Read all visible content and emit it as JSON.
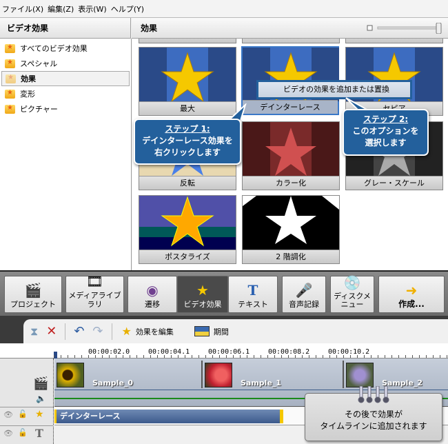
{
  "menu": [
    "ファイル(X)",
    "編集(Z)",
    "表示(W)",
    "ヘルプ(Y)"
  ],
  "left_panel": {
    "title": "ビデオ効果",
    "items": [
      "すべてのビデオ効果",
      "スペシャル",
      "効果",
      "変形",
      "ピクチャー"
    ],
    "selected": "効果"
  },
  "right_panel": {
    "title": "効果"
  },
  "tiles": [
    {
      "label": "最大"
    },
    {
      "label": "デインターレース"
    },
    {
      "label": "セピア"
    },
    {
      "label": "反転"
    },
    {
      "label": "カラー化"
    },
    {
      "label": "グレー・スケール"
    },
    {
      "label": "ポスタライズ"
    },
    {
      "label": "2 階調化"
    }
  ],
  "context_menu": {
    "item": "ビデオの効果を追加または置換"
  },
  "callout1": {
    "title": "ステップ 1:",
    "line1": "デインターレース効果を",
    "line2": "右クリックします"
  },
  "callout2": {
    "title": "ステップ 2:",
    "line1": "このオプションを",
    "line2": "選択します"
  },
  "toolbar": [
    "プロジェクト",
    "メディアライブラリ",
    "遷移",
    "ビデオ効果",
    "テキスト",
    "音声記録",
    "ディスクメニュー",
    "作成..."
  ],
  "toolbar_active": "ビデオ効果",
  "timeline_toolbar": {
    "edit_effect": "効果を編集",
    "duration": "期間"
  },
  "ruler": [
    "00:00:02.0",
    "00:00:04.1",
    "00:00:06.1",
    "00:00:08.2",
    "00:00:10.2"
  ],
  "clips": [
    "Sample_0",
    "Sample_1",
    "Sample_2"
  ],
  "effect_clip": "デインターレース",
  "tip": {
    "line1": "その後で効果が",
    "line2": "タイムラインに追加されます"
  }
}
